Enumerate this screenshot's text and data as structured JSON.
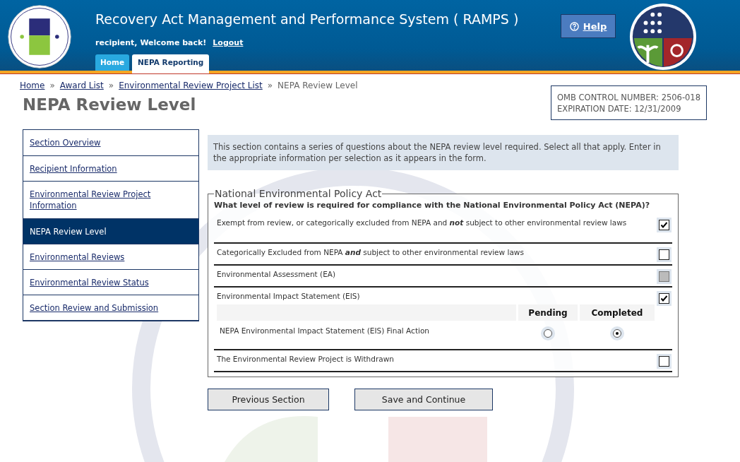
{
  "header": {
    "title": "Recovery Act Management and Performance System ( RAMPS )",
    "welcome": "recipient, Welcome back!",
    "logout": "Logout",
    "help": "Help"
  },
  "tabs": [
    {
      "label": "Home",
      "selected": false
    },
    {
      "label": "NEPA Reporting",
      "selected": true
    }
  ],
  "breadcrumb": [
    {
      "label": "Home",
      "kind": "link"
    },
    {
      "label": "Award List",
      "kind": "link",
      "separator": "»"
    },
    {
      "label": "Environmental Review Project List",
      "kind": "link",
      "separator": "»"
    },
    {
      "label": "NEPA Review Level",
      "kind": "current",
      "separator": "»"
    }
  ],
  "page_title": "NEPA Review Level",
  "omb": [
    "OMB CONTROL NUMBER: 2506-018",
    "EXPIRATION DATE: 12/31/2009"
  ],
  "sidebar": {
    "items": [
      {
        "label": "Section Overview",
        "selected": false
      },
      {
        "label": "Recipient Information",
        "selected": false
      },
      {
        "label": "Environmental Review Project Information",
        "selected": false
      },
      {
        "label": "NEPA Review Level",
        "selected": true
      },
      {
        "label": "Environmental Reviews",
        "selected": false
      },
      {
        "label": "Environmental Review Status",
        "selected": false
      },
      {
        "label": "Section Review and Submission",
        "selected": false
      }
    ]
  },
  "intro": "This section contains a series of questions about the NEPA review level required. Select all that apply. Enter in the appropriate information per selection as it appears in the form.",
  "form": {
    "legend": "National Environmental Policy Act",
    "question": "What level of review is required for compliance with the National Environmental Policy Act (NEPA)?",
    "options": [
      {
        "label": "Exempt from review, or categorically excluded from NEPA and **not** subject to other environmental review laws",
        "checked": true,
        "disabled": false
      },
      {
        "label": "Categorically Excluded from NEPA **and** subject to other environmental review laws",
        "checked": false,
        "disabled": false
      },
      {
        "label": "Environmental Assessment (EA)",
        "checked": false,
        "disabled": true
      },
      {
        "label": "Environmental Impact Statement (EIS)",
        "checked": true,
        "disabled": false,
        "subtable": {
          "columns": [
            "Pending",
            "Completed"
          ],
          "rows": [
            {
              "label": "NEPA Environmental Impact Statement (EIS) Final Action",
              "choices": [
                {
                  "selected": false
                },
                {
                  "selected": true
                }
              ]
            }
          ]
        }
      },
      {
        "label": "The Environmental Review Project is Withdrawn",
        "checked": false,
        "disabled": false
      }
    ]
  },
  "buttons": [
    "Previous Section",
    "Save and Continue"
  ]
}
